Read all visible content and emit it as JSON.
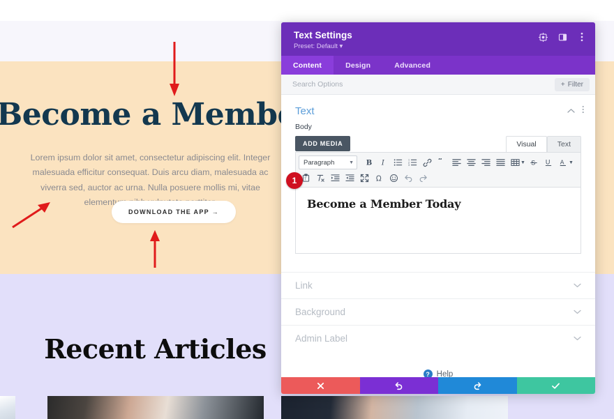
{
  "website": {
    "hero_title": "Become a Member Today",
    "hero_paragraph": "Lorem ipsum dolor sit amet, consectetur adipiscing elit. Integer malesuada efficitur consequat. Duis arcu diam, malesuada ac viverra sed, auctor ac urna. Nulla posuere mollis mi, vitae elementum nibh vulputate porttitor.",
    "hero_button": "DOWNLOAD THE APP →",
    "recent_title": "Recent Articles",
    "colors": {
      "hero_bg": "#fbe3c0",
      "hero_text": "#13384f",
      "articles_bg": "#e2dffa",
      "annotation_arrow": "#e01b1b"
    }
  },
  "panel": {
    "title": "Text Settings",
    "preset": "Preset: Default ▾",
    "header_icons": [
      {
        "name": "focus-target-icon"
      },
      {
        "name": "layout-split-icon"
      },
      {
        "name": "kebab-menu-icon"
      }
    ],
    "tabs": [
      {
        "label": "Content",
        "active": true
      },
      {
        "label": "Design",
        "active": false
      },
      {
        "label": "Advanced",
        "active": false
      }
    ],
    "search": {
      "placeholder": "Search Options",
      "value": ""
    },
    "filter_button": "Filter",
    "accent_color": "#6c2eb9",
    "section": {
      "title": "Text",
      "collapse_icon": "chevron-up-icon",
      "menu_icon": "kebab-menu-icon"
    },
    "body_field": {
      "label": "Body",
      "add_media": "ADD MEDIA",
      "editor_tabs": [
        {
          "label": "Visual",
          "active": true
        },
        {
          "label": "Text",
          "active": false
        }
      ],
      "format_select": "Paragraph",
      "toolbar_row1": [
        "bold-icon",
        "italic-icon",
        "bulleted-list-icon",
        "numbered-list-icon",
        "link-icon",
        "blockquote-icon",
        "align-left-icon",
        "align-center-icon",
        "align-right-icon",
        "align-justify-icon",
        "table-icon",
        "strikethrough-icon",
        "underline-icon",
        "text-color-icon"
      ],
      "toolbar_row2": [
        "paste-as-text-icon",
        "clear-formatting-icon",
        "outdent-icon",
        "indent-icon",
        "fullscreen-icon",
        "special-character-icon",
        "emoji-icon",
        "undo-icon",
        "redo-icon"
      ],
      "content": "Become a Member Today",
      "step_badge": "1"
    },
    "accordions": [
      {
        "label": "Link"
      },
      {
        "label": "Background"
      },
      {
        "label": "Admin Label"
      }
    ],
    "help": {
      "label": "Help",
      "icon": "question-mark-icon"
    },
    "footer_buttons": [
      {
        "name": "cancel-button",
        "icon": "close-icon",
        "color": "#ec5a5a"
      },
      {
        "name": "undo-button",
        "icon": "undo-arrow-icon",
        "color": "#7b2fd4"
      },
      {
        "name": "redo-button",
        "icon": "redo-arrow-icon",
        "color": "#2089d8"
      },
      {
        "name": "save-button",
        "icon": "checkmark-icon",
        "color": "#3ec6a0"
      }
    ]
  }
}
